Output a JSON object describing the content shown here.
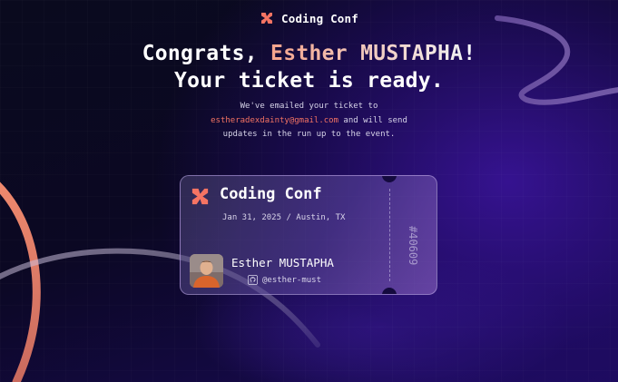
{
  "brand": {
    "name": "Coding Conf",
    "logo_icon": "coding-conf-logo-icon"
  },
  "headline": {
    "greeting": "Congrats, ",
    "name": "Esther MUSTAPHA",
    "punct": "!",
    "line2": "Your ticket is ready."
  },
  "message": {
    "line1": "We've emailed your ticket to",
    "email": "estheradexdainty@gmail.com",
    "line2_rest": " and will send",
    "line3": "updates in the run up to the event."
  },
  "ticket": {
    "event": "Coding Conf",
    "meta": "Jan 31, 2025 / Austin, TX",
    "number": "#40609",
    "attendee_name": "Esther MUSTAPHA",
    "github_handle": "@esther-must",
    "github_icon": "github-icon"
  },
  "colors": {
    "accent_orange": "#f57463",
    "gradient_start": "#f4a38b",
    "ticket_border": "#bea9e6"
  }
}
